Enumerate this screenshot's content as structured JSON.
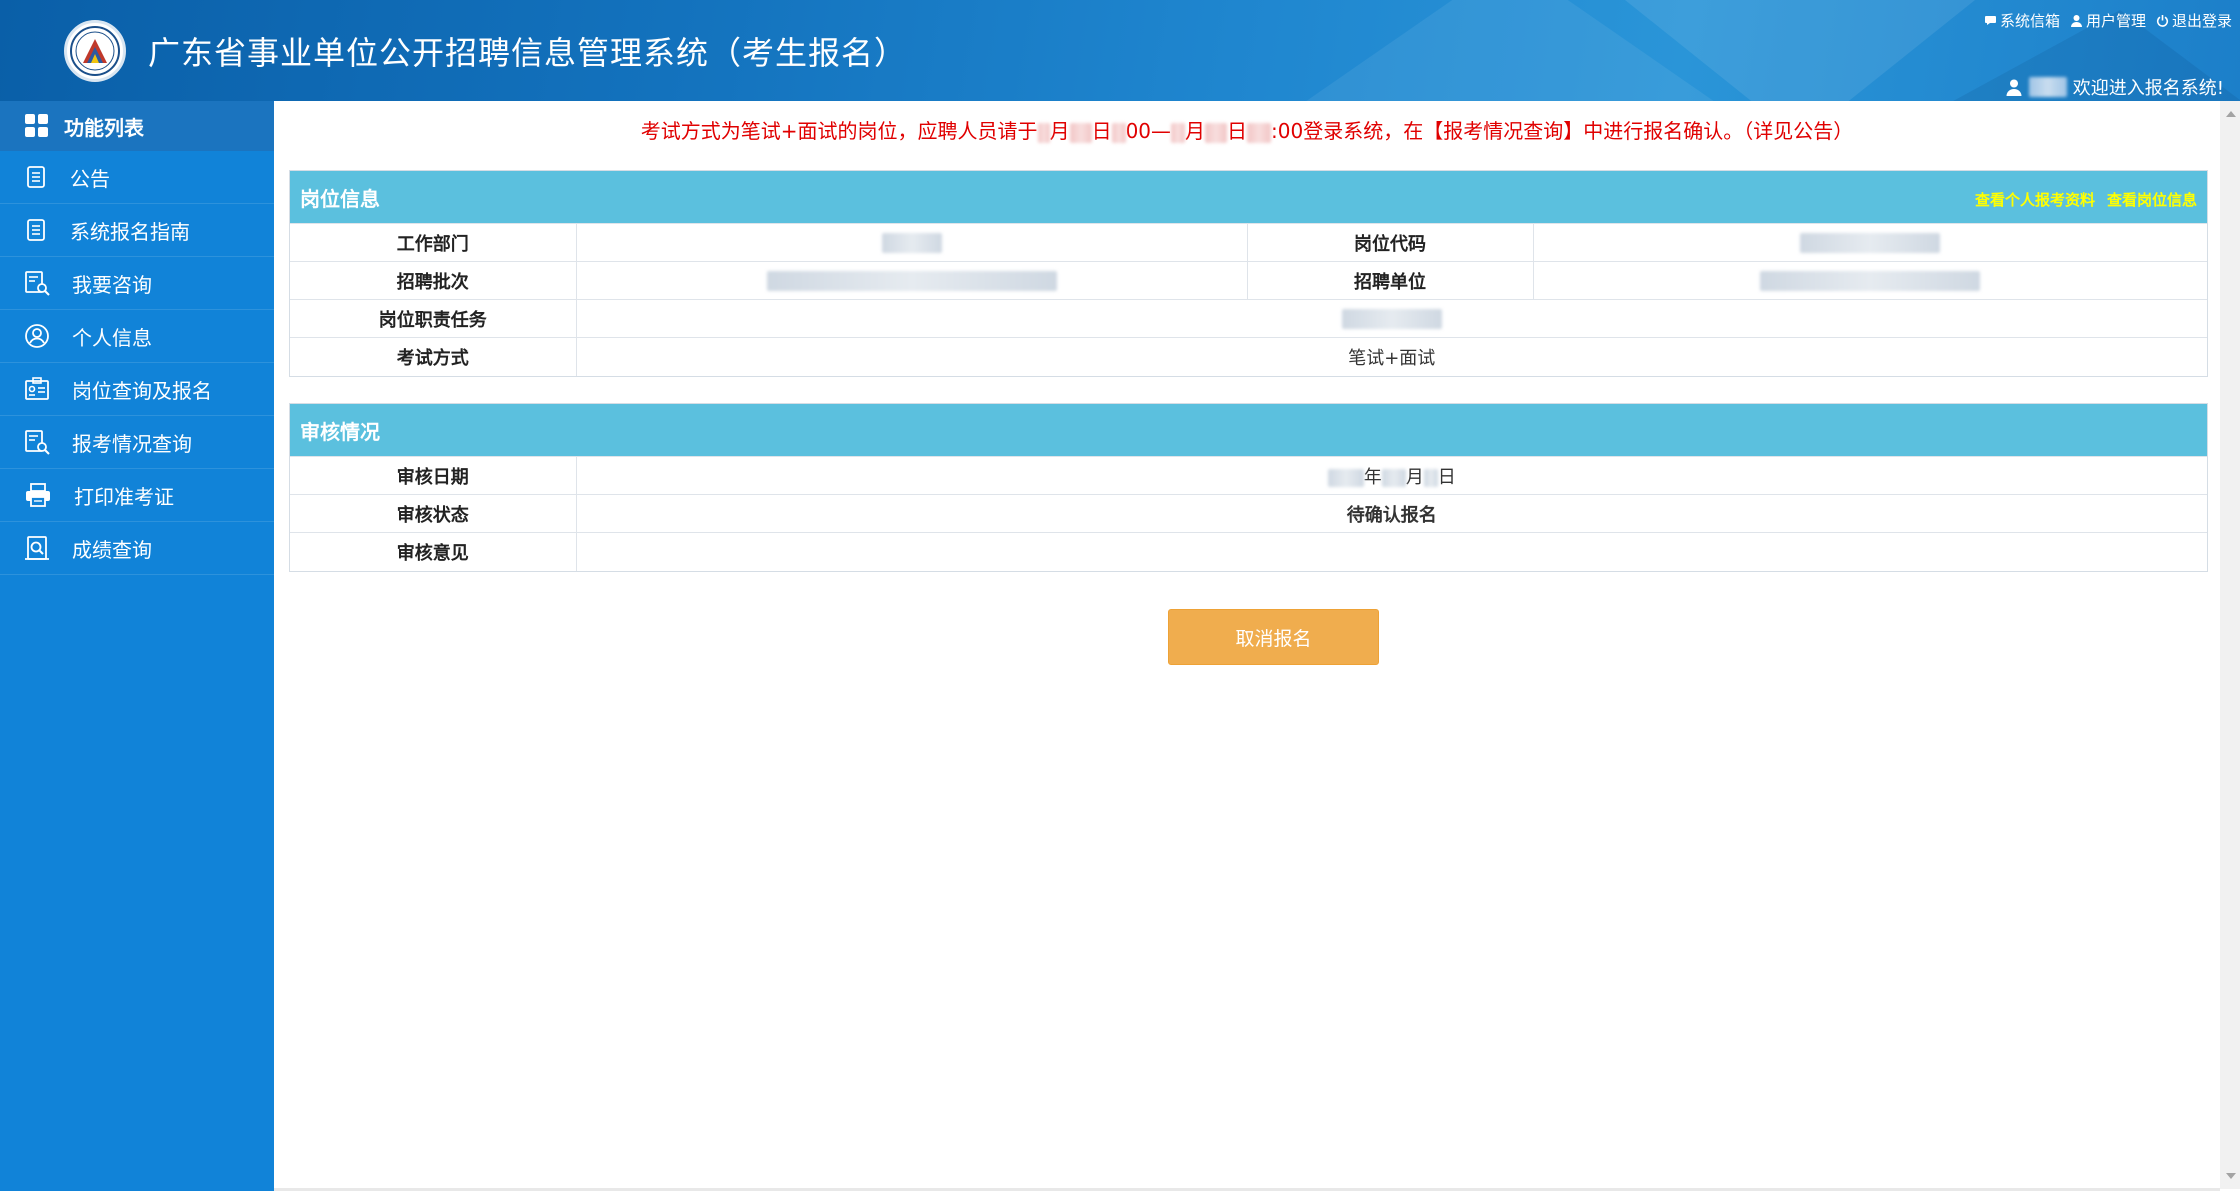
{
  "header": {
    "title": "广东省事业单位公开招聘信息管理系统（考生报名）",
    "links": [
      {
        "icon": "message-icon",
        "label": "系统信箱"
      },
      {
        "icon": "user-icon",
        "label": "用户管理"
      },
      {
        "icon": "power-icon",
        "label": "退出登录"
      }
    ],
    "welcome": "欢迎进入报名系统!"
  },
  "sidebar": {
    "heading": "功能列表",
    "items": [
      {
        "icon": "document-list-icon",
        "label": "公告"
      },
      {
        "icon": "document-list-icon",
        "label": "系统报名指南"
      },
      {
        "icon": "document-search-icon",
        "label": "我要咨询"
      },
      {
        "icon": "user-circle-icon",
        "label": "个人信息"
      },
      {
        "icon": "id-card-search-icon",
        "label": "岗位查询及报名"
      },
      {
        "icon": "document-search-icon",
        "label": "报考情况查询"
      },
      {
        "icon": "printer-icon",
        "label": "打印准考证"
      },
      {
        "icon": "score-search-icon",
        "label": "成绩查询"
      }
    ]
  },
  "notice": {
    "part1": "考试方式为笔试+面试的岗位，应聘人员请于",
    "m1": "月",
    "d1": "日",
    "t1": "00—",
    "m2": "月",
    "d2": "日",
    "t2": ":00登录系统，在【报考情况查询】中进行报名确认。（详见公告）"
  },
  "position_panel": {
    "title": "岗位信息",
    "link_profile": "查看个人报考资料",
    "link_position": "查看岗位信息",
    "rows": {
      "dept_label": "工作部门",
      "code_label": "岗位代码",
      "batch_label": "招聘批次",
      "unit_label": "招聘单位",
      "duty_label": "岗位职责任务",
      "exam_label": "考试方式",
      "exam_value": "笔试+面试"
    }
  },
  "review_panel": {
    "title": "审核情况",
    "date_label": "审核日期",
    "date_year": "年",
    "date_month": "月",
    "date_day": "日",
    "status_label": "审核状态",
    "status_value": "待确认报名",
    "opinion_label": "审核意见",
    "opinion_value": ""
  },
  "actions": {
    "cancel_label": "取消报名"
  },
  "colors": {
    "header_blue": "#1372bd",
    "sidebar_blue": "#1183d8",
    "panel_head": "#5bc0de",
    "notice_red": "#e00000",
    "button_orange": "#f0ad4e",
    "link_yellow": "#ffff00"
  }
}
